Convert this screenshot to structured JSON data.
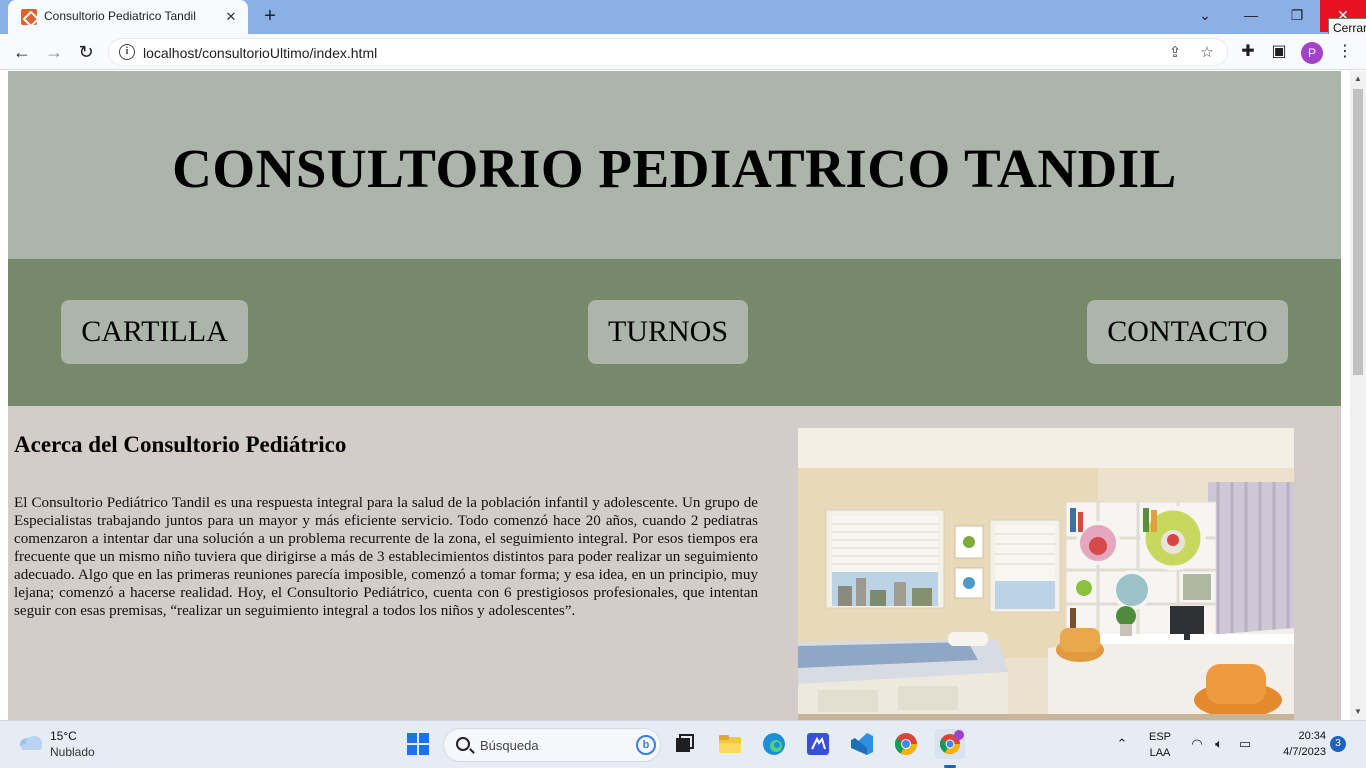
{
  "browser": {
    "tab_title": "Consultorio Pediatrico Tandil",
    "tab_close": "✕",
    "new_tab": "+",
    "url": "localhost/consultorioUltimo/index.html",
    "tooltip": "Cerrar",
    "window_controls": {
      "list": "⌄",
      "minimize": "—",
      "restore": "❐",
      "close": "✕"
    },
    "profile_initial": "P"
  },
  "site": {
    "title": "CONSULTORIO PEDIATRICO TANDIL",
    "nav": {
      "cartilla": "CARTILLA",
      "turnos": "TURNOS",
      "contacto": "CONTACTO"
    },
    "about_title": "Acerca del Consultorio Pediátrico",
    "about_text": "El Consultorio Pediátrico Tandil es una respuesta integral para la salud de la población infantil y adolescente. Un grupo de Especialistas trabajando juntos para un mayor y más eficiente servicio. Todo comenzó hace 20 años, cuando 2 pediatras comenzaron a intentar dar una solución a un problema recurrente de la zona, el seguimiento integral. Por esos tiempos era frecuente que un mismo niño tuviera que dirigirse a más de 3 establecimientos distintos para poder realizar un seguimiento adecuado. Algo que en las primeras reuniones parecía imposible, comenzó a tomar forma; y esa idea, en un principio, muy lejana; comenzó a hacerse realidad. Hoy, el Consultorio Pediátrico, cuenta con 6 prestigiosos profesionales, que intentan seguir con esas premisas, “realizar un seguimiento integral a todos los niños y adolescentes”."
  },
  "taskbar": {
    "weather_temp": "15°C",
    "weather_desc": "Nublado",
    "search_placeholder": "Búsqueda",
    "lang_top": "ESP",
    "lang_bottom": "LAA",
    "time": "20:34",
    "date": "4/7/2023",
    "notifications": "3"
  },
  "colors": {
    "header_bg": "#acb5a9",
    "nav_bg": "#77896b",
    "main_bg": "#d3ccc8",
    "tabbar_bg": "#8ab0e6"
  }
}
